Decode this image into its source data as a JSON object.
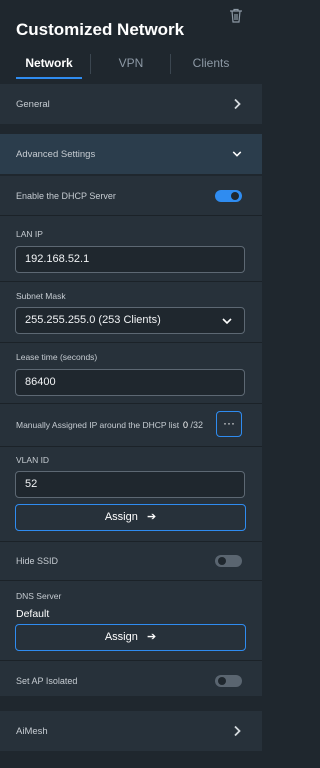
{
  "header": {
    "title": "Customized Network",
    "trash_icon": "trash-icon"
  },
  "tabs": [
    {
      "label": "Network",
      "active": true
    },
    {
      "label": "VPN",
      "active": false
    },
    {
      "label": "Clients",
      "active": false
    }
  ],
  "sections": {
    "general": "General",
    "advanced": "Advanced Settings",
    "aimesh": "AiMesh"
  },
  "dhcp": {
    "enable_label": "Enable the DHCP Server",
    "enabled": true
  },
  "lan_ip": {
    "label": "LAN IP",
    "value": "192.168.52.1"
  },
  "subnet": {
    "label": "Subnet Mask",
    "value": "255.255.255.0 (253 Clients)"
  },
  "lease": {
    "label": "Lease time (seconds)",
    "value": "86400"
  },
  "manual_ip": {
    "label": "Manually Assigned IP around the DHCP list",
    "count": "0",
    "total": "/32",
    "more_label": "···"
  },
  "vlan": {
    "label": "VLAN ID",
    "value": "52",
    "assign_label": "Assign",
    "arrow": "➔"
  },
  "hide_ssid": {
    "label": "Hide SSID",
    "enabled": false
  },
  "dns": {
    "label": "DNS Server",
    "value": "Default",
    "assign_label": "Assign",
    "arrow": "➔"
  },
  "ap_isolated": {
    "label": "Set AP Isolated",
    "enabled": false
  },
  "colors": {
    "accent": "#2f8cf0",
    "background": "#1f272e",
    "panel": "#27313a"
  }
}
